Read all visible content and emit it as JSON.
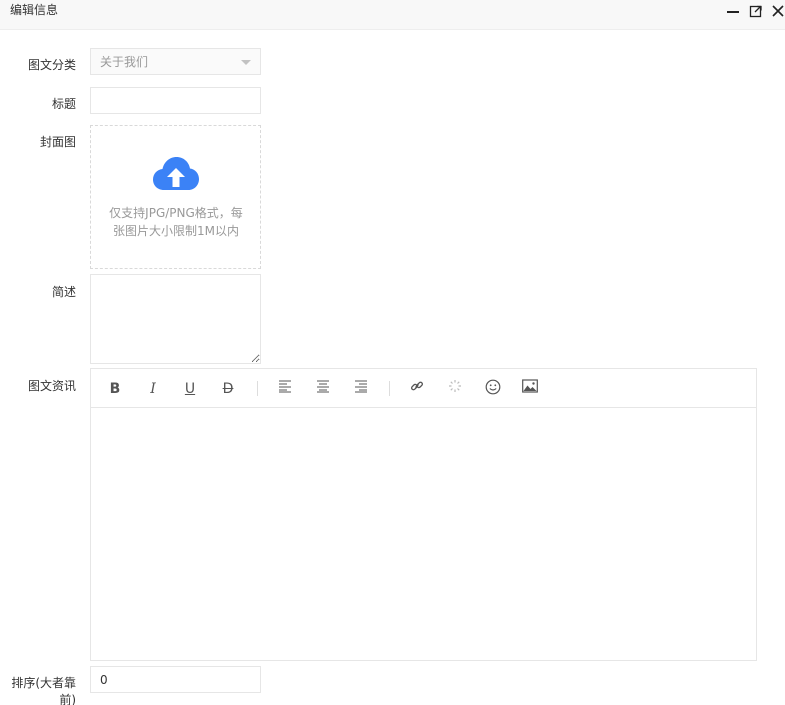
{
  "window": {
    "title": "编辑信息",
    "icons": [
      "minimize-icon",
      "maximize-icon",
      "close-icon"
    ]
  },
  "form": {
    "category": {
      "label": "图文分类",
      "value": "关于我们"
    },
    "title_field": {
      "label": "标题",
      "value": ""
    },
    "cover": {
      "label": "封面图",
      "hint": "仅支持JPG/PNG格式，每张图片大小限制1M以内",
      "icon": "cloud-upload-icon"
    },
    "summary": {
      "label": "简述",
      "value": ""
    },
    "content": {
      "label": "图文资讯"
    },
    "sort": {
      "label": "排序(大者靠前)",
      "value": "0"
    }
  },
  "editor_toolbar": [
    {
      "name": "bold-icon",
      "glyph": "B"
    },
    {
      "name": "italic-icon",
      "glyph": "I"
    },
    {
      "name": "underline-icon",
      "glyph": "U"
    },
    {
      "name": "strikethrough-icon",
      "glyph": "D"
    },
    {
      "name": "align-left-icon"
    },
    {
      "name": "align-center-icon"
    },
    {
      "name": "align-right-icon"
    },
    {
      "name": "link-icon"
    },
    {
      "name": "unlink-icon"
    },
    {
      "name": "emoji-icon"
    },
    {
      "name": "image-icon"
    }
  ],
  "colors": {
    "accent": "#3b82f6",
    "border": "#e6e6e6",
    "placeholder": "#999999"
  }
}
